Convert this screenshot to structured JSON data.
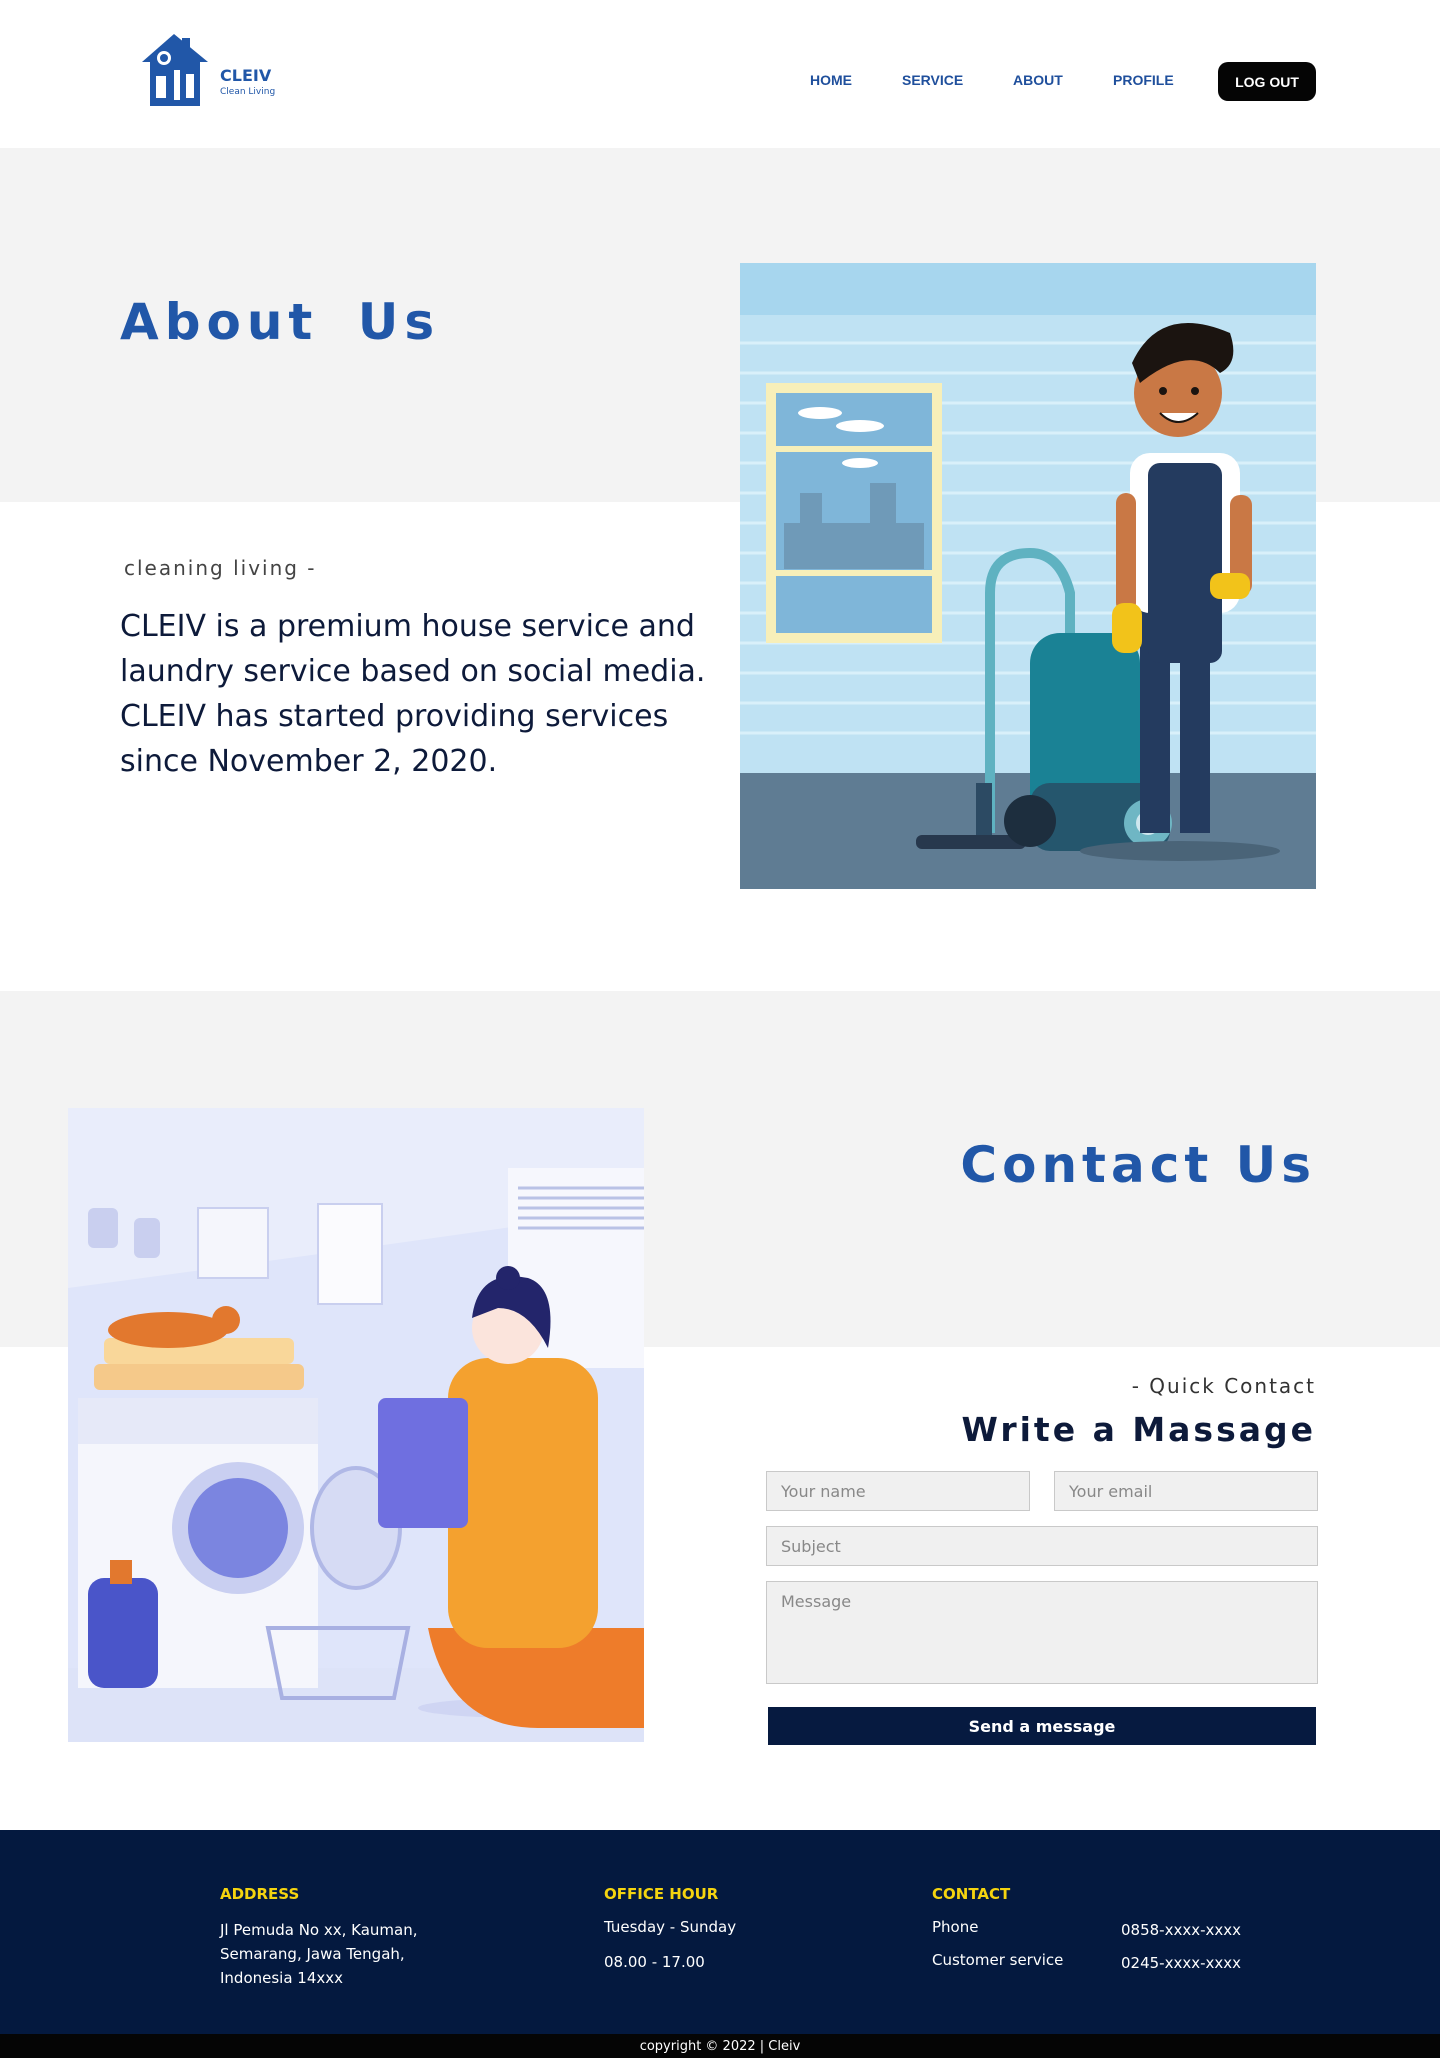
{
  "header": {
    "logo_text": "CLEIV",
    "logo_sub": "Clean Living",
    "nav": [
      "HOME",
      "SERVICE",
      "ABOUT",
      "PROFILE"
    ],
    "logout_label": "LOG OUT"
  },
  "about": {
    "title": "About  Us",
    "tagline": "cleaning living  -",
    "body": "CLEIV is a premium house service and laundry service based on social media. CLEIV has started providing services since November 2, 2020."
  },
  "contact": {
    "title": "Contact Us",
    "quick": "- Quick Contact",
    "heading": "Write a Massage",
    "name_placeholder": "Your name",
    "email_placeholder": "Your email",
    "subject_placeholder": "Subject",
    "message_placeholder": "Message",
    "send_label": "Send a message"
  },
  "footer": {
    "address_title": "ADDRESS",
    "address_lines": [
      "Jl Pemuda  No xx, Kauman,",
      "Semarang, Jawa Tengah,",
      "Indonesia 14xxx"
    ],
    "office_title": "OFFICE HOUR",
    "office_days": "Tuesday - Sunday",
    "office_time": "08.00 - 17.00",
    "contact_title": "CONTACT",
    "phone_label": "Phone",
    "phone_value": "0858-xxxx-xxxx",
    "cs_label": "Customer service",
    "cs_value": "0245-xxxx-xxxx",
    "copyright": "copyright © 2022 | Cleiv"
  },
  "colors": {
    "brand": "#2157a8",
    "navy": "#04193f",
    "accent_yellow": "#f5d40f"
  }
}
